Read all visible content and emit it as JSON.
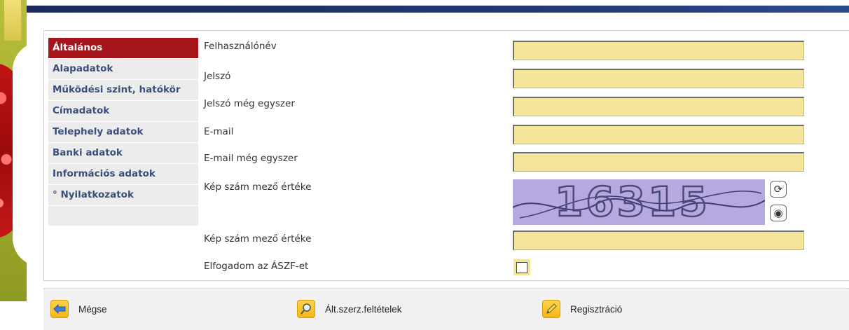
{
  "menu": {
    "items": [
      {
        "label": "Általános"
      },
      {
        "label": "Alapadatok"
      },
      {
        "label": "Működési szint, hatókör"
      },
      {
        "label": "Címadatok"
      },
      {
        "label": "Telephely adatok"
      },
      {
        "label": "Banki adatok"
      },
      {
        "label": "Információs adatok"
      },
      {
        "label": "° Nyilatkozatok"
      }
    ]
  },
  "form": {
    "username_label": "Felhasználónév",
    "password_label": "Jelszó",
    "password_again_label": "Jelszó még egyszer",
    "email_label": "E-mail",
    "email_again_label": "E-mail még egyszer",
    "captcha_image_label": "Kép szám mező értéke",
    "captcha_input_label": "Kép szám mező értéke",
    "captcha_text": "16315",
    "terms_label": "Elfogadom az ÁSZF-et"
  },
  "footer": {
    "cancel": "Mégse",
    "terms": "Ált.szerz.feltételek",
    "register": "Regisztráció"
  },
  "colors": {
    "accent_active": "#a5151b",
    "field_bg": "#f5e59a",
    "menu_text": "#3a4f7a"
  }
}
